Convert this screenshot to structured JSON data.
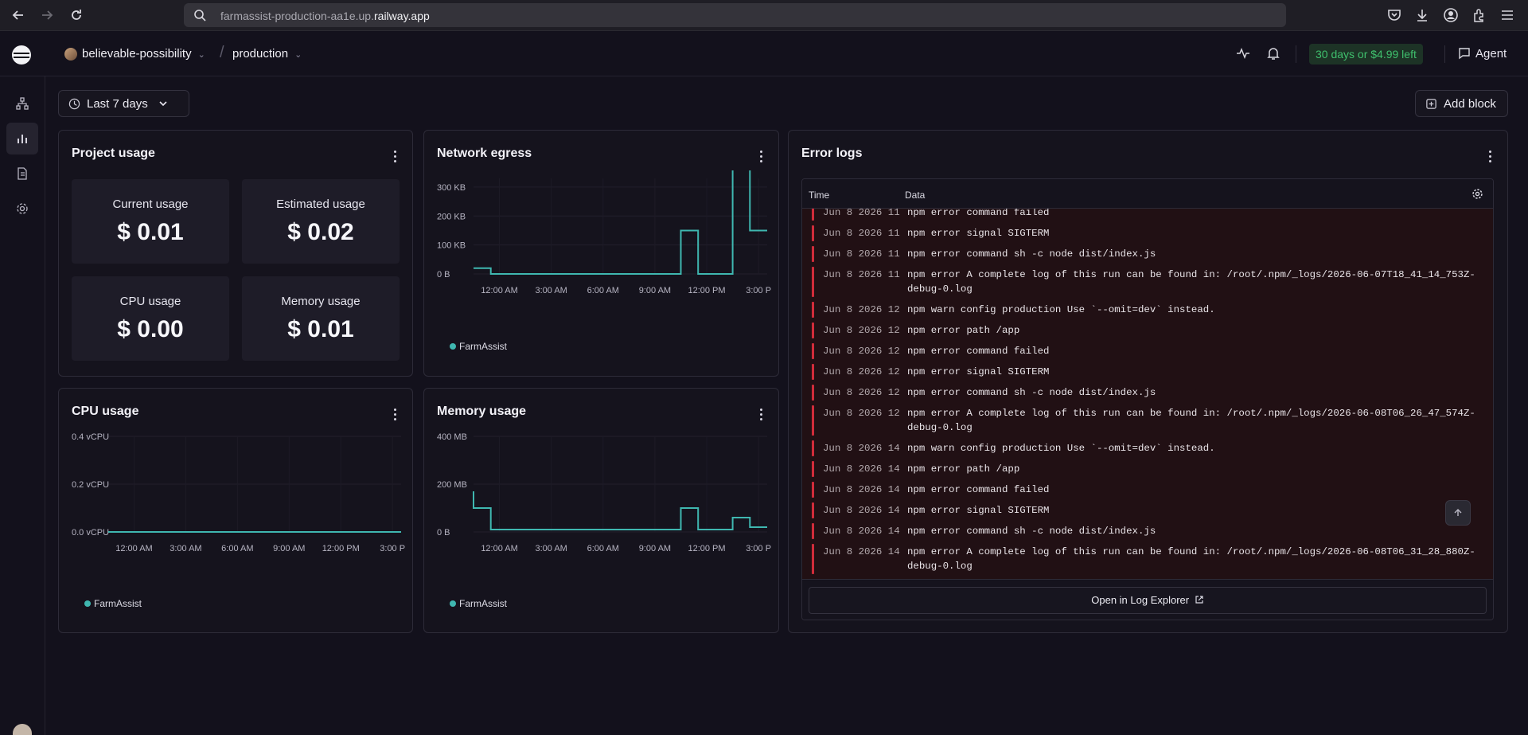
{
  "browser": {
    "url_prefix": "farmassist-production-aa1e.up.",
    "url_domain": "railway.app"
  },
  "header": {
    "project": "believable-possibility",
    "environment": "production",
    "trial": "30 days or $4.99 left",
    "agent": "Agent"
  },
  "toolbar": {
    "range": "Last 7 days",
    "add_block": "Add block"
  },
  "project_usage": {
    "title": "Project usage",
    "stats": [
      {
        "label": "Current usage",
        "value": "$ 0.01"
      },
      {
        "label": "Estimated usage",
        "value": "$ 0.02"
      },
      {
        "label": "CPU usage",
        "value": "$ 0.00"
      },
      {
        "label": "Memory usage",
        "value": "$ 0.01"
      }
    ]
  },
  "network": {
    "title": "Network egress",
    "legend": "FarmAssist"
  },
  "cpu": {
    "title": "CPU usage",
    "legend": "FarmAssist"
  },
  "memory": {
    "title": "Memory usage",
    "legend": "FarmAssist"
  },
  "error_logs": {
    "title": "Error logs",
    "col_time": "Time",
    "col_data": "Data",
    "open_button": "Open in Log Explorer",
    "rows": [
      {
        "time": "Jun 8 2026 11",
        "msg": "npm error command failed"
      },
      {
        "time": "Jun 8 2026 11",
        "msg": "npm error signal SIGTERM"
      },
      {
        "time": "Jun 8 2026 11",
        "msg": "npm error command sh -c node dist/index.js"
      },
      {
        "time": "Jun 8 2026 11",
        "msg": "npm error A complete log of this run can be found in: /root/.npm/_logs/2026-06-07T18_41_14_753Z-debug-0.log"
      },
      {
        "time": "Jun 8 2026 12",
        "msg": "npm warn config production Use `--omit=dev` instead."
      },
      {
        "time": "Jun 8 2026 12",
        "msg": "npm error path /app"
      },
      {
        "time": "Jun 8 2026 12",
        "msg": "npm error command failed"
      },
      {
        "time": "Jun 8 2026 12",
        "msg": "npm error signal SIGTERM"
      },
      {
        "time": "Jun 8 2026 12",
        "msg": "npm error command sh -c node dist/index.js"
      },
      {
        "time": "Jun 8 2026 12",
        "msg": "npm error A complete log of this run can be found in: /root/.npm/_logs/2026-06-08T06_26_47_574Z-debug-0.log"
      },
      {
        "time": "Jun 8 2026 14",
        "msg": "npm warn config production Use `--omit=dev` instead."
      },
      {
        "time": "Jun 8 2026 14",
        "msg": "npm error path /app"
      },
      {
        "time": "Jun 8 2026 14",
        "msg": "npm error command failed"
      },
      {
        "time": "Jun 8 2026 14",
        "msg": "npm error signal SIGTERM"
      },
      {
        "time": "Jun 8 2026 14",
        "msg": "npm error command sh -c node dist/index.js"
      },
      {
        "time": "Jun 8 2026 14",
        "msg": "npm error A complete log of this run can be found in: /root/.npm/_logs/2026-06-08T06_31_28_880Z-debug-0.log"
      }
    ]
  },
  "colors": {
    "series": "#3fb7b0",
    "error_bar": "#d12c3a",
    "trial_green": "#3fbf6d"
  },
  "chart_data": [
    {
      "type": "line",
      "title": "Network egress",
      "x_ticks": [
        "12:00 AM",
        "3:00 AM",
        "6:00 AM",
        "9:00 AM",
        "12:00 PM",
        "3:00 P"
      ],
      "y_ticks": [
        "0 B",
        "100 KB",
        "200 KB",
        "300 KB"
      ],
      "ylim": [
        0,
        330
      ],
      "step": true,
      "series": [
        {
          "name": "FarmAssist",
          "x": [
            -1.5,
            -0.5,
            -0.5,
            10.5,
            10.5,
            11.5,
            11.5,
            13.5,
            13.5,
            14.5,
            14.5,
            15.5
          ],
          "y": [
            20,
            20,
            0,
            0,
            150,
            150,
            0,
            0,
            390,
            390,
            150,
            150
          ]
        }
      ]
    },
    {
      "type": "line",
      "title": "CPU usage",
      "x_ticks": [
        "12:00 AM",
        "3:00 AM",
        "6:00 AM",
        "9:00 AM",
        "12:00 PM",
        "3:00 P"
      ],
      "y_ticks": [
        "0.0 vCPU",
        "0.2 vCPU",
        "0.4 vCPU"
      ],
      "ylim": [
        0,
        0.4
      ],
      "step": true,
      "series": [
        {
          "name": "FarmAssist",
          "x": [
            -1.5,
            15.5
          ],
          "y": [
            0,
            0
          ]
        }
      ]
    },
    {
      "type": "line",
      "title": "Memory usage",
      "x_ticks": [
        "12:00 AM",
        "3:00 AM",
        "6:00 AM",
        "9:00 AM",
        "12:00 PM",
        "3:00 P"
      ],
      "y_ticks": [
        "0 B",
        "200 MB",
        "400 MB"
      ],
      "ylim": [
        0,
        400
      ],
      "step": true,
      "series": [
        {
          "name": "FarmAssist",
          "x": [
            -1.5,
            -1.5,
            -0.5,
            -0.5,
            10.5,
            10.5,
            11.5,
            11.5,
            13.5,
            13.5,
            14.5,
            14.5,
            15.5
          ],
          "y": [
            170,
            100,
            100,
            10,
            10,
            100,
            100,
            10,
            10,
            60,
            60,
            20,
            20
          ]
        }
      ]
    }
  ]
}
